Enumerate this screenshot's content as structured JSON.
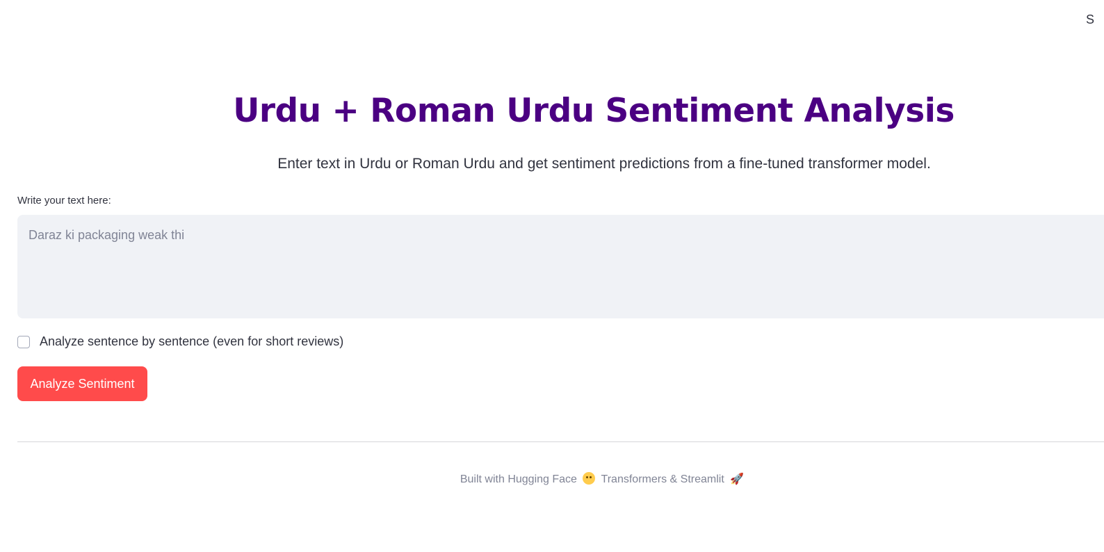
{
  "corner": {
    "text": "S"
  },
  "header": {
    "title": "Urdu + Roman Urdu Sentiment Analysis",
    "subtitle": "Enter text in Urdu or Roman Urdu and get sentiment predictions from a fine-tuned transformer model."
  },
  "form": {
    "input_label": "Write your text here:",
    "input_placeholder": "Daraz ki packaging weak thi",
    "input_value": "",
    "checkbox_label": "Analyze sentence by sentence (even for short reviews)",
    "checkbox_checked": false,
    "button_label": "Analyze Sentiment"
  },
  "footer": {
    "text_before": "Built with Hugging Face",
    "text_middle": "Transformers & Streamlit",
    "hug_icon": "hugging-face-emoji-icon",
    "rocket_icon": "rocket-icon",
    "rocket_glyph": "🚀"
  },
  "colors": {
    "title": "#4b0082",
    "button": "#ff4b4b",
    "input_bg": "#f0f2f6"
  }
}
